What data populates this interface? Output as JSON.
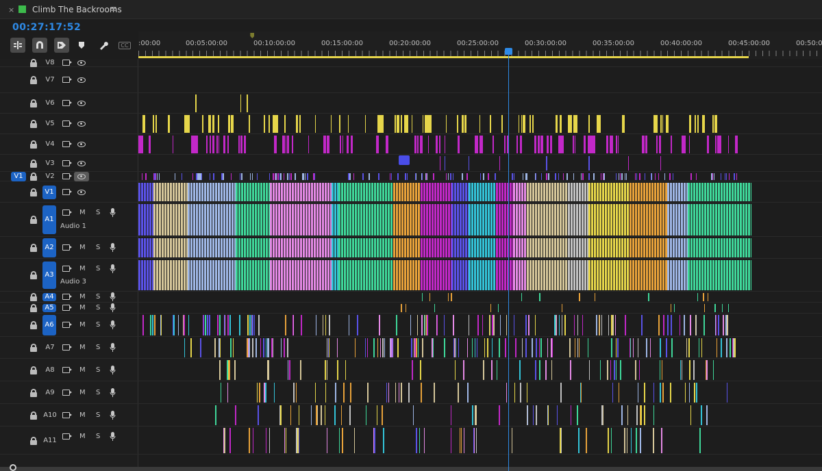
{
  "tab": {
    "title": "Climb The Backrooms",
    "close_icon": "×",
    "menu_icon": "≡",
    "label_color": "#3dbb4c"
  },
  "timecode": "00:27:17:52",
  "toolbar": {
    "cc_label": "CC"
  },
  "ruler": {
    "labels": [
      ":00:00",
      "00:05:00:00",
      "00:10:00:00",
      "00:15:00:00",
      "00:20:00:00",
      "00:25:00:00",
      "00:30:00:00",
      "00:35:00:00",
      "00:40:00:00",
      "00:45:00:00",
      "00:50:0"
    ],
    "playhead_time_sec": 1637,
    "work_area_end_sec": 2700,
    "in_marker_sec": 504
  },
  "source_patch": {
    "video": "V1"
  },
  "video_tracks": [
    {
      "name": "V8"
    },
    {
      "name": "V7"
    },
    {
      "name": "V6"
    },
    {
      "name": "V5"
    },
    {
      "name": "V4"
    },
    {
      "name": "V3"
    },
    {
      "name": "V2"
    },
    {
      "name": "V1",
      "targeted": true
    }
  ],
  "audio_tracks": [
    {
      "name": "A1",
      "label": "Audio 1",
      "m": "M",
      "s": "S",
      "targeted": true
    },
    {
      "name": "A2",
      "m": "M",
      "s": "S",
      "targeted": true
    },
    {
      "name": "A3",
      "label": "Audio 3",
      "m": "M",
      "s": "S",
      "targeted": true
    },
    {
      "name": "A4",
      "m": "M",
      "s": "S",
      "targeted": true
    },
    {
      "name": "A5",
      "m": "M",
      "s": "S",
      "targeted": true
    },
    {
      "name": "A6",
      "m": "M",
      "s": "S",
      "targeted": true
    },
    {
      "name": "A7",
      "m": "M",
      "s": "S"
    },
    {
      "name": "A8",
      "m": "M",
      "s": "S"
    },
    {
      "name": "A9",
      "m": "M",
      "s": "S"
    },
    {
      "name": "A10",
      "m": "M",
      "s": "S"
    },
    {
      "name": "A11",
      "m": "M",
      "s": "S"
    }
  ],
  "clip_palette": [
    "#e6d64a",
    "#c228c8",
    "#5a52e8",
    "#3fd89a",
    "#e8a23a",
    "#e58ae6",
    "#9fb7e6",
    "#d6c79a",
    "#33c4d9",
    "#c2c2c2"
  ],
  "colors": {
    "accent": "#2e8ae6",
    "target": "#1c63c4",
    "background": "#1d1d1d"
  }
}
